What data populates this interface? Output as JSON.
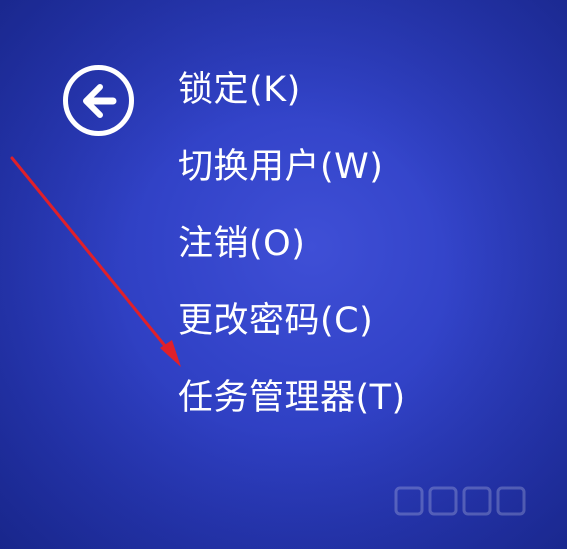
{
  "menu": {
    "items": [
      {
        "label": "锁定(K)"
      },
      {
        "label": "切换用户(W)"
      },
      {
        "label": "注销(O)"
      },
      {
        "label": "更改密码(C)"
      },
      {
        "label": "任务管理器(T)"
      }
    ]
  },
  "back_button": {
    "icon": "arrow-left-icon"
  },
  "annotation": {
    "arrow_color": "#e0202a",
    "points_to": "任务管理器(T)"
  },
  "colors": {
    "background": "#3243c8",
    "text": "#ffffff"
  }
}
